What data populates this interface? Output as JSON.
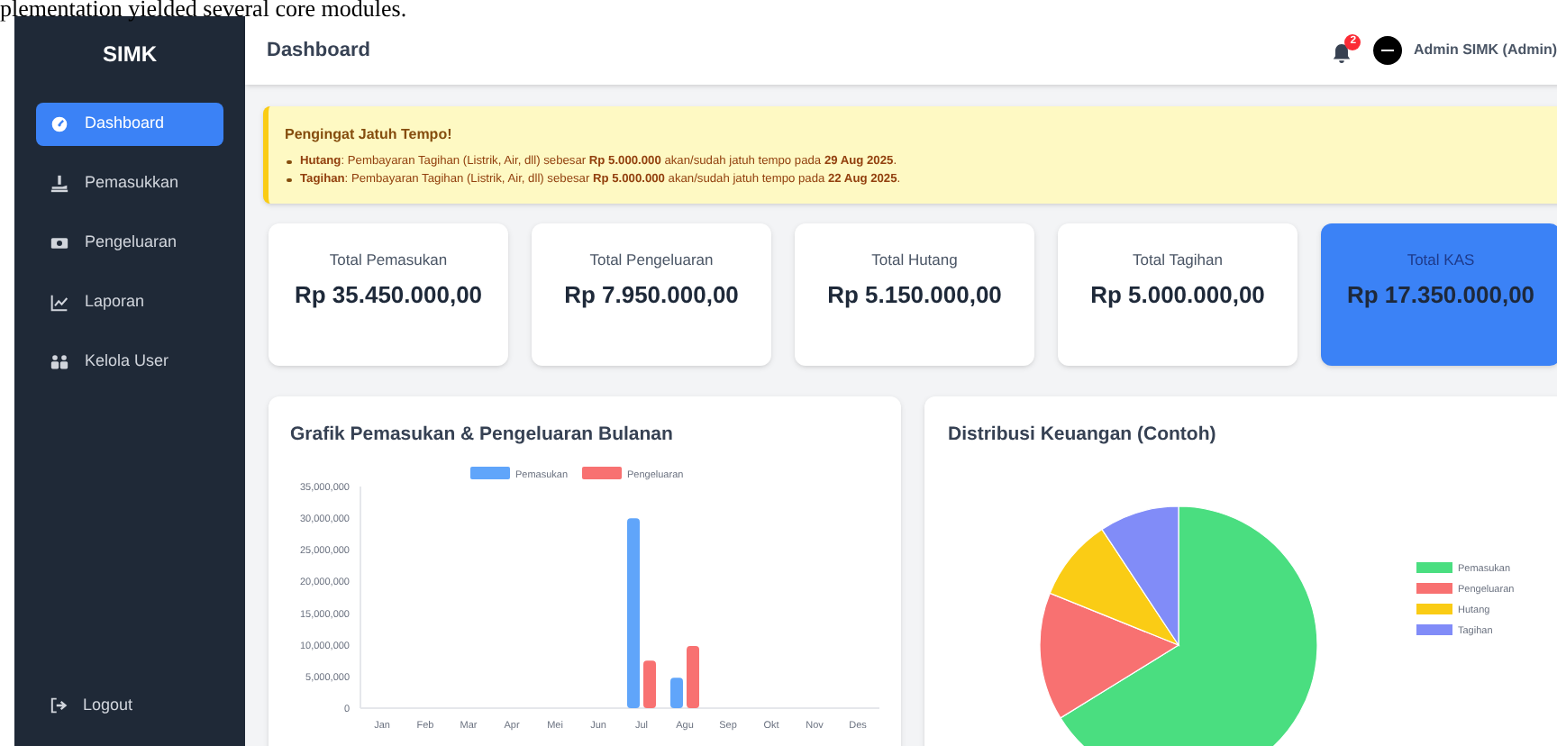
{
  "document_text": "plementation yielded several core modules.",
  "sidebar": {
    "title": "SIMK",
    "items": [
      {
        "label": "Dashboard",
        "selected": true
      },
      {
        "label": "Pemasukkan",
        "selected": false
      },
      {
        "label": "Pengeluaran",
        "selected": false
      },
      {
        "label": "Laporan",
        "selected": false
      },
      {
        "label": "Kelola User",
        "selected": false
      }
    ],
    "logout": "Logout"
  },
  "header": {
    "title": "Dashboard",
    "notification_count": "2",
    "user": "Admin SIMK (Admin)"
  },
  "alert": {
    "title": "Pengingat Jatuh Tempo!",
    "items": [
      "**Hutang**: Pembayaran Tagihan (Listrik, Air, dll) sebesar **Rp 5.000.000** akan/sudah jatuh tempo pada **29 Aug 2025**.",
      "**Tagihan**: Pembayaran Tagihan (Listrik, Air, dll) sebesar **Rp 5.000.000** akan/sudah jatuh tempo pada **22 Aug 2025**."
    ]
  },
  "cards": [
    {
      "label": "Total Pemasukan",
      "value": "Rp 35.450.000,00",
      "kind": "plain"
    },
    {
      "label": "Total Pengeluaran",
      "value": "Rp 7.950.000,00",
      "kind": "plain"
    },
    {
      "label": "Total Hutang",
      "value": "Rp 5.150.000,00",
      "kind": "plain"
    },
    {
      "label": "Total Tagihan",
      "value": "Rp 5.000.000,00",
      "kind": "plain"
    },
    {
      "label": "Total KAS",
      "value": "Rp 17.350.000,00",
      "kind": "highlight"
    }
  ],
  "bar_panel": {
    "title": "Grafik Pemasukan & Pengeluaran Bulanan",
    "chart_data": {
      "type": "bar",
      "categories": [
        "Jan",
        "Feb",
        "Mar",
        "Apr",
        "Mei",
        "Jun",
        "Jul",
        "Agu",
        "Sep",
        "Okt",
        "Nov",
        "Des"
      ],
      "series": [
        {
          "name": "Pemasukan",
          "color": "#60a5fa",
          "values": [
            0,
            0,
            0,
            0,
            0,
            0,
            30000000,
            4800000,
            0,
            0,
            0,
            0
          ]
        },
        {
          "name": "Pengeluaran",
          "color": "#f87171",
          "values": [
            0,
            0,
            0,
            0,
            0,
            0,
            7500000,
            9800000,
            0,
            0,
            0,
            0
          ]
        }
      ],
      "legend": true,
      "ylim": [
        0,
        35000000
      ],
      "yticks": [
        {
          "value": 0,
          "label": "0"
        },
        {
          "value": 5000000,
          "label": "5,000,000"
        },
        {
          "value": 10000000,
          "label": "10,000,000"
        },
        {
          "value": 15000000,
          "label": "15,000,000"
        },
        {
          "value": 20000000,
          "label": "20,000,000"
        },
        {
          "value": 25000000,
          "label": "25,000,000"
        },
        {
          "value": 30000000,
          "label": "30,000,000"
        },
        {
          "value": 35000000,
          "label": "35,000,000"
        }
      ]
    }
  },
  "pie_panel": {
    "title": "Distribusi Keuangan (Contoh)",
    "chart_data": {
      "type": "pie",
      "categories": [
        "Pemasukan",
        "Pengeluaran",
        "Hutang",
        "Tagihan"
      ],
      "values": [
        66.2,
        14.9,
        9.6,
        9.3
      ],
      "colors": [
        "#4ade80",
        "#f87171",
        "#facc15",
        "#818cf8"
      ],
      "legend": true
    }
  }
}
